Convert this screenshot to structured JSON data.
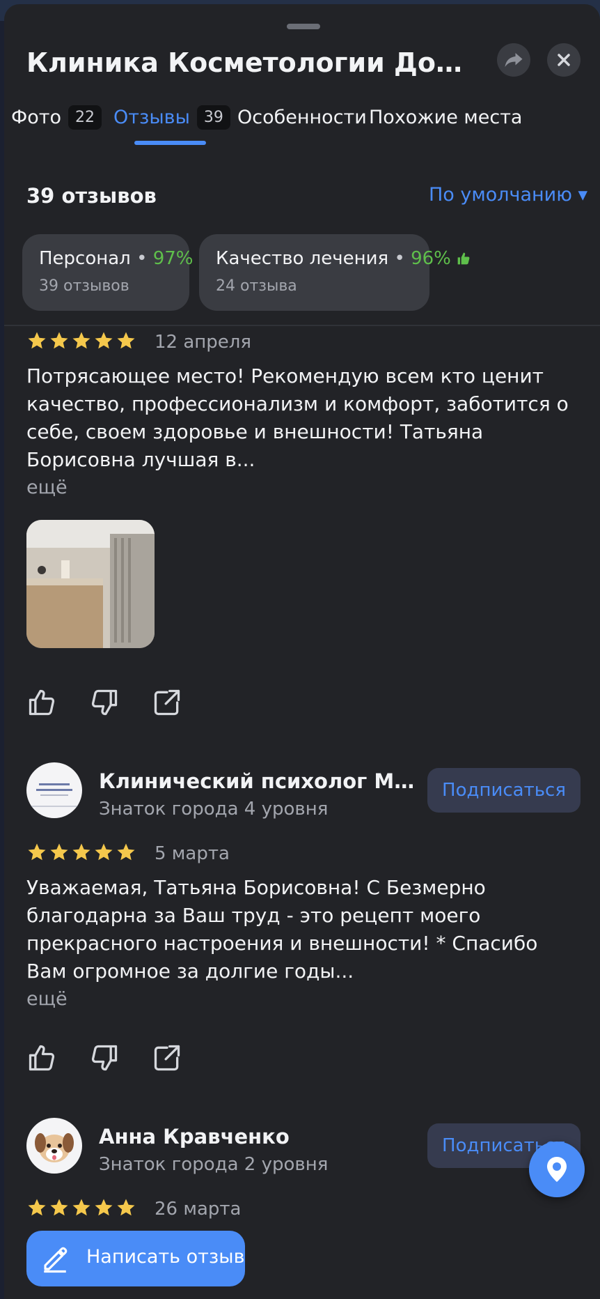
{
  "header": {
    "title": "Клиника Косметологии Доктора...",
    "share_icon": "share-arrow-icon",
    "close_icon": "close-icon"
  },
  "tabs": [
    {
      "label": "Фото",
      "count": "22",
      "active": false
    },
    {
      "label": "Отзывы",
      "count": "39",
      "active": true
    },
    {
      "label": "Особенности",
      "count": "",
      "active": false
    },
    {
      "label": "Похожие места",
      "count": "",
      "active": false
    }
  ],
  "summary": {
    "reviews_count": "39 отзывов",
    "sort_label": "По умолчанию ▾"
  },
  "aspects": [
    {
      "name": "Персонал",
      "dot": "•",
      "percent": "97%",
      "sub": "39 отзывов"
    },
    {
      "name": "Качество лечения",
      "dot": "•",
      "percent": "96%",
      "sub": "24 отзыва"
    }
  ],
  "reviews": [
    {
      "rating": 5,
      "date": "12 апреля",
      "text": "Потрясающее место! Рекомендую всем кто ценит качество, профессионализм и комфорт, заботится о себе, своем здоровье и внешности! Татьяна Борисовна лучшая в...",
      "more": "ещё"
    },
    {
      "author": "Клинический психолог Мар...",
      "level": "Знаток города 4 уровня",
      "subscribe": "Подписаться",
      "rating": 5,
      "date": "5 марта",
      "text": "Уважаемая, Татьяна Борисовна! С Безмерно благодарна за Ваш труд - это рецепт моего прекрасного настроения и внешности! * Спасибо Вам огромное за долгие годы...",
      "more": "ещё"
    },
    {
      "author": "Анна Кравченко",
      "level": "Знаток города 2 уровня",
      "subscribe": "Подписаться",
      "rating": 5,
      "date": "26 марта"
    }
  ],
  "write_review_label": "Написать отзыв",
  "colors": {
    "accent": "#4a8cf7",
    "background": "#222327",
    "chip": "#3a3c42",
    "star": "#f5c84c",
    "positive": "#5fbf4b"
  }
}
